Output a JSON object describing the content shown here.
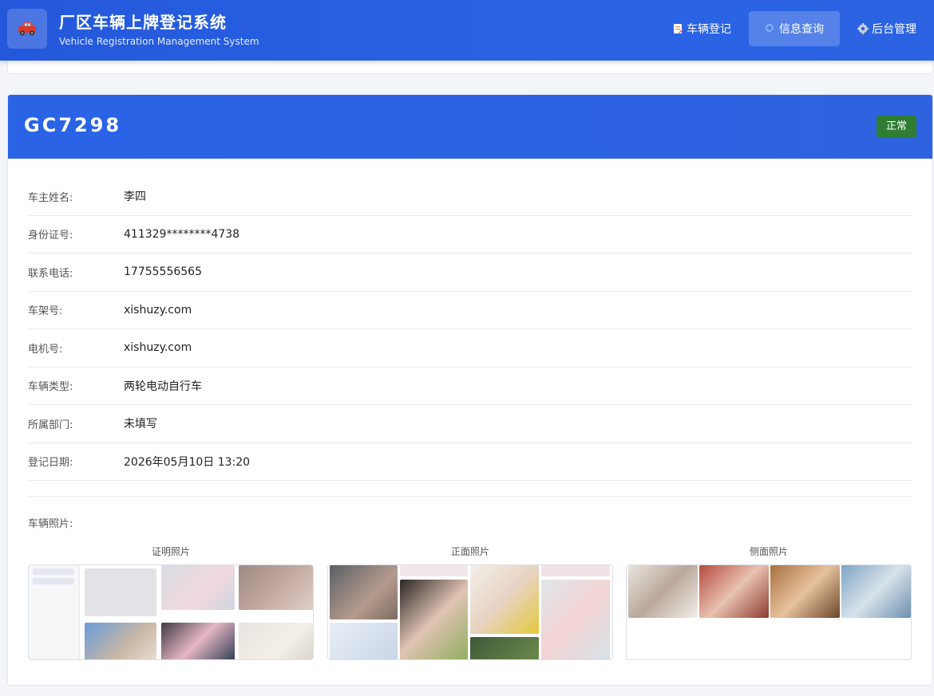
{
  "header": {
    "title": "厂区车辆上牌登记系统",
    "subtitle": "Vehicle Registration Management System",
    "nav": [
      {
        "label": "车辆登记",
        "icon": "register-icon"
      },
      {
        "label": "信息查询",
        "icon": "search-icon"
      },
      {
        "label": "后台管理",
        "icon": "gear-icon"
      }
    ]
  },
  "vehicle": {
    "plate": "GC7298",
    "status": "正常",
    "fields": [
      {
        "label": "车主姓名:",
        "value": "李四"
      },
      {
        "label": "身份证号:",
        "value": "411329********4738"
      },
      {
        "label": "联系电话:",
        "value": "17755556565"
      },
      {
        "label": "车架号:",
        "value": "xishuzy.com"
      },
      {
        "label": "电机号:",
        "value": "xishuzy.com"
      },
      {
        "label": "车辆类型:",
        "value": "两轮电动自行车"
      },
      {
        "label": "所属部门:",
        "value": "未填写"
      },
      {
        "label": "登记日期:",
        "value": "2026年05月10日 13:20"
      }
    ]
  },
  "photos": {
    "label": "车辆照片:",
    "items": [
      {
        "caption": "证明照片"
      },
      {
        "caption": "正面照片"
      },
      {
        "caption": "侧面照片"
      }
    ]
  },
  "colors": {
    "primary": "#2a63e6",
    "status_ok": "#2e7d32"
  }
}
